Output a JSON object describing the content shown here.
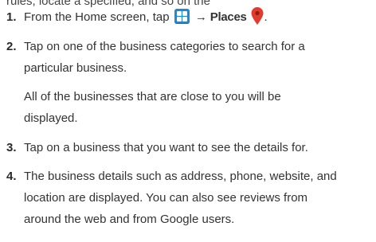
{
  "header": {
    "cut_text": "rules, locate a specified, and so on the"
  },
  "steps": [
    {
      "number": "1.",
      "parts": {
        "before": "From the Home screen, tap",
        "arrow": "→",
        "places": "Places",
        "after": "."
      },
      "icons": [
        "apps-grid-icon",
        "places-pin-icon"
      ]
    },
    {
      "number": "2.",
      "lines": [
        "Tap on one of the business categories to search for a",
        "particular business."
      ],
      "note_lines": [
        "All of the businesses that are close to you will be",
        "displayed."
      ]
    },
    {
      "number": "3.",
      "lines": [
        "Tap on a business that you want to see the details for."
      ]
    },
    {
      "number": "4.",
      "lines": [
        "The business details such as address, phone, website, and",
        "location are displayed. You can also see reviews from",
        "around the web and from Google users."
      ]
    }
  ],
  "colors": {
    "apps_icon": "#1a8ad9",
    "pin_icon": "#e23b2e"
  }
}
